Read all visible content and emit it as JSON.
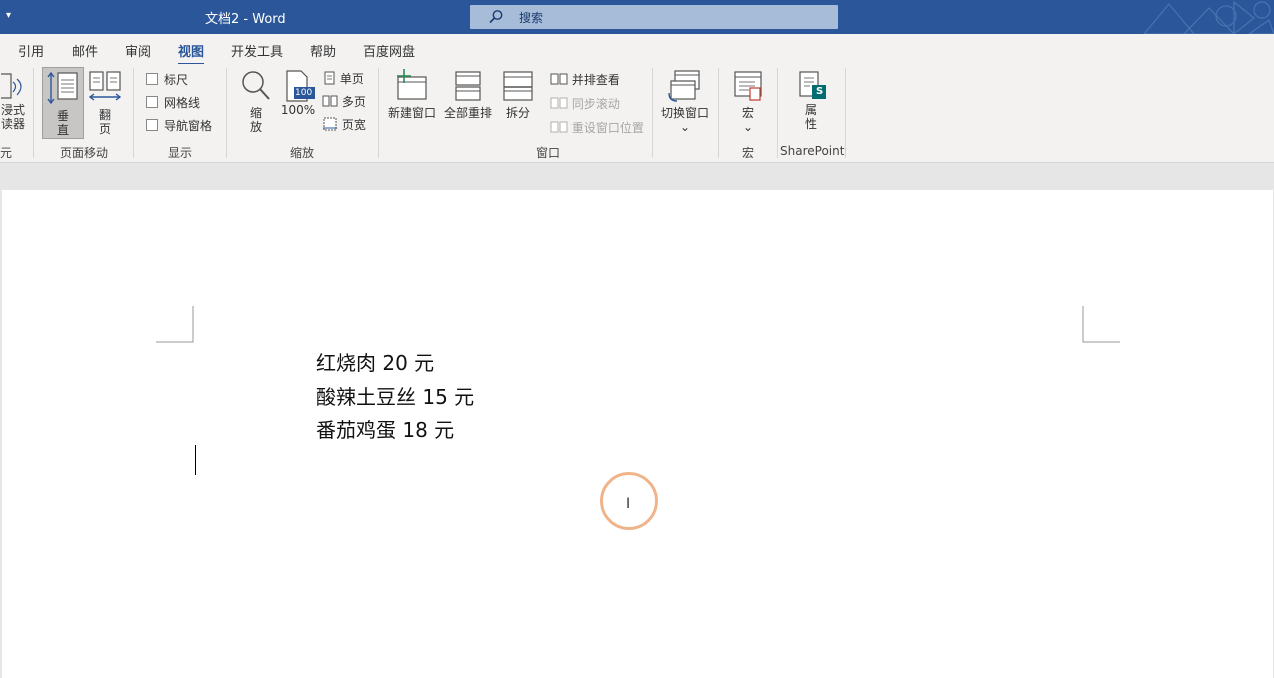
{
  "titlebar": {
    "qa_glyph": "▾",
    "title": "文档2  -  Word",
    "search_placeholder": "搜索",
    "bg": "#2b579a"
  },
  "tabs": [
    {
      "label": "引用"
    },
    {
      "label": "邮件"
    },
    {
      "label": "审阅"
    },
    {
      "label": "视图",
      "active": true
    },
    {
      "label": "开发工具"
    },
    {
      "label": "帮助"
    },
    {
      "label": "百度网盘"
    }
  ],
  "ribbon": {
    "immersive_reader": {
      "line1": "浸式",
      "line2": "读器"
    },
    "partial_group": "元",
    "page_move": {
      "vertical": {
        "line1": "垂",
        "line2": "直"
      },
      "flip": {
        "line1": "翻",
        "line2": "页"
      },
      "group_label": "页面移动"
    },
    "show": {
      "ruler": "标尺",
      "gridlines": "网格线",
      "nav_pane": "导航窗格",
      "group_label": "显示"
    },
    "zoom": {
      "zoom": {
        "line1": "缩",
        "line2": "放"
      },
      "hundred": "100%",
      "hundred_icon_text": "100",
      "one_page": "单页",
      "multi_page": "多页",
      "page_width": "页宽",
      "group_label": "缩放"
    },
    "window": {
      "new_window": "新建窗口",
      "arrange_all": "全部重排",
      "split": "拆分",
      "side_by_side": "并排查看",
      "sync_scroll": "同步滚动",
      "reset_pos": "重设窗口位置",
      "switch": "切换窗口",
      "switch_arrow": "⌄",
      "group_label": "窗口"
    },
    "macros": {
      "label": "宏",
      "arrow": "⌄",
      "group_label": "宏"
    },
    "sharepoint": {
      "props": {
        "line1": "属",
        "line2": "性"
      },
      "icon_letter": "S",
      "group_label": "SharePoint"
    }
  },
  "document": {
    "lines": [
      "红烧肉 20 元",
      "酸辣土豆丝 15 元",
      "番茄鸡蛋 18 元"
    ]
  },
  "cursor": {
    "glyph": "I"
  }
}
